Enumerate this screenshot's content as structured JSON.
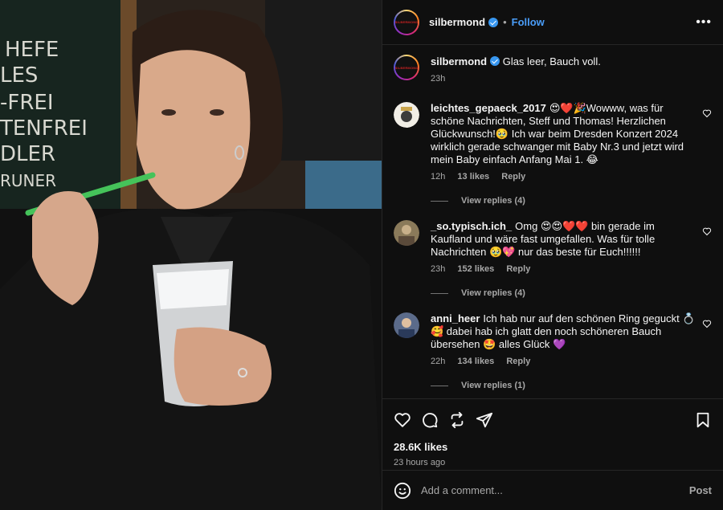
{
  "post": {
    "username": "silbermond",
    "follow_label": "Follow",
    "separator": "•",
    "more_label": "•••",
    "avatar_text": "SILBERMOND",
    "caption": {
      "username": "silbermond",
      "text": "Glas leer, Bauch voll.",
      "time": "23h"
    },
    "photo": {
      "chalkboard_lines": [
        "HEFE",
        "LES",
        "-FREI",
        "TENFREI",
        "DLER",
        "RUNER"
      ]
    }
  },
  "comments": [
    {
      "username": "leichtes_gepaeck_2017",
      "text": "😍❤️🎉Wowww, was für schöne Nachrichten, Steff und Thomas! Herzlichen Glückwunsch!🥹 Ich war beim Dresden Konzert 2024 wirklich gerade schwanger mit Baby Nr.3 und jetzt wird mein Baby einfach Anfang Mai 1. 😂",
      "time": "12h",
      "likes": "13 likes",
      "reply": "Reply",
      "view_replies": "View replies (4)"
    },
    {
      "username": "_so.typisch.ich_",
      "text": "Omg 😍😍❤️❤️ bin gerade im Kaufland und wäre fast umgefallen. Was für tolle Nachrichten 🥹💖 nur das beste für Euch!!!!!!",
      "time": "23h",
      "likes": "152 likes",
      "reply": "Reply",
      "view_replies": "View replies (4)"
    },
    {
      "username": "anni_heer",
      "text": "Ich hab nur auf den schönen Ring geguckt 💍🥰 dabei hab ich glatt den noch schöneren Bauch übersehen 🤩 alles Glück 💜",
      "time": "22h",
      "likes": "134 likes",
      "reply": "Reply",
      "view_replies": "View replies (1)"
    }
  ],
  "actions": {
    "likes": "28.6K likes",
    "time_ago": "23 hours ago"
  },
  "add_comment": {
    "placeholder": "Add a comment...",
    "post_label": "Post"
  },
  "colors": {
    "accent": "#4a9df8",
    "background": "#0f0f0f",
    "muted": "#a8a8a8"
  }
}
